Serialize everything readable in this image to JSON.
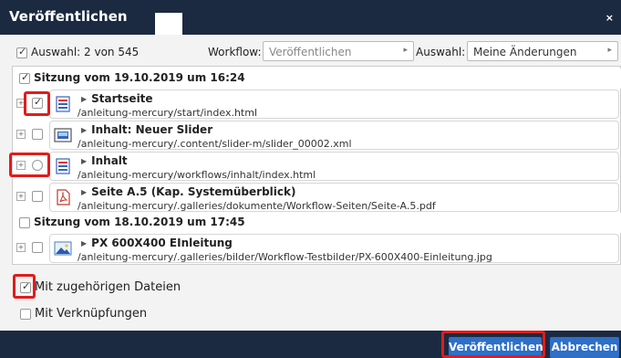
{
  "dialog": {
    "title": "Veröffentlichen",
    "close": "×"
  },
  "toolbar": {
    "count_label": "Auswahl: 2 von 545",
    "workflow_label": "Workflow:",
    "workflow_value": "Veröffentlichen",
    "selection_label": "Auswahl:",
    "selection_value": "Meine Änderungen"
  },
  "sessions": [
    {
      "label": "Sitzung vom 19.10.2019 um 16:24"
    },
    {
      "label": "Sitzung vom 18.10.2019 um 17:45"
    }
  ],
  "files": [
    {
      "name": "Startseite",
      "path": "/anleitung-mercury/start/index.html",
      "icon": "page-icon"
    },
    {
      "name": "Inhalt: Neuer Slider",
      "path": "/anleitung-mercury/.content/slider-m/slider_00002.xml",
      "icon": "slider-icon"
    },
    {
      "name": "Inhalt",
      "path": "/anleitung-mercury/workflows/inhalt/index.html",
      "icon": "page-icon"
    },
    {
      "name": "Seite A.5 (Kap. Systemüberblick)",
      "path": "/anleitung-mercury/.galleries/dokumente/Workflow-Seiten/Seite-A.5.pdf",
      "icon": "pdf-icon"
    },
    {
      "name": "PX 600X400 EInleitung",
      "path": "/anleitung-mercury/.galleries/bilder/Workflow-Testbilder/PX-600X400-Einleitung.jpg",
      "icon": "image-icon"
    }
  ],
  "options": {
    "related_files": "Mit zugehörigen Dateien",
    "links": "Mit Verknüpfungen"
  },
  "buttons": {
    "publish": "Veröffentlichen",
    "cancel": "Abbrechen"
  },
  "colors": {
    "header": "#1b2a40",
    "button": "#2e6fc8",
    "highlight": "#e31b1b"
  }
}
